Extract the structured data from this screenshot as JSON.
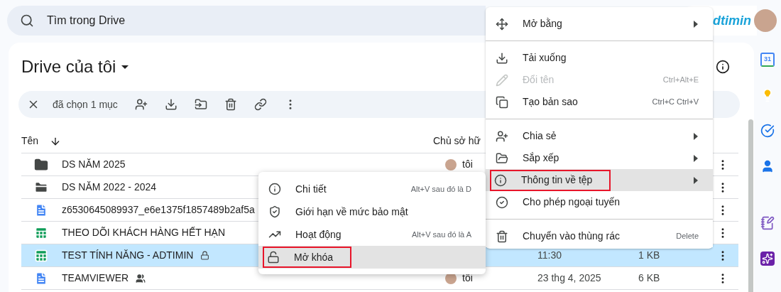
{
  "search": {
    "placeholder": "Tìm trong Drive"
  },
  "logo": "dtimin",
  "title": "Drive của tôi",
  "selection_bar": {
    "label": "đã chọn 1 mục"
  },
  "table": {
    "columns": [
      "Tên",
      "Chủ sở hữ"
    ],
    "rows": [
      {
        "kind": "folder",
        "name": "DS NĂM 2025",
        "owner": "tôi",
        "selected": false
      },
      {
        "kind": "shared-folder",
        "name": "DS NĂM 2022 - 2024",
        "selected": false
      },
      {
        "kind": "doc",
        "name": "z6530645089937_e6e1375f1857489b2af5a",
        "selected": false
      },
      {
        "kind": "sheet",
        "name": "THEO DÕI KHÁCH HÀNG HẾT HẠN",
        "selected": false
      },
      {
        "kind": "sheet",
        "name": "TEST TÍNH NĂNG - ADTIMIN",
        "locked": true,
        "date": "11:30",
        "size": "1 KB",
        "selected": true
      },
      {
        "kind": "doc",
        "name": "TEAMVIEWER",
        "shared": true,
        "owner": "tôi",
        "date": "23 thg 4, 2025",
        "size": "6 KB",
        "selected": false
      }
    ]
  },
  "context_menu": {
    "groups": [
      [
        {
          "label": "Mở bằng",
          "submenu": true,
          "disabled": false,
          "selected": false,
          "outlined": false
        }
      ],
      [
        {
          "label": "Tải xuống",
          "submenu": false,
          "disabled": false,
          "selected": false,
          "outlined": false
        },
        {
          "label": "Đổi tên",
          "shortcut": "Ctrl+Alt+E",
          "submenu": false,
          "disabled": true,
          "selected": false,
          "outlined": false
        },
        {
          "label": "Tạo bản sao",
          "shortcut": "Ctrl+C Ctrl+V",
          "submenu": false,
          "disabled": false,
          "selected": false,
          "outlined": false
        }
      ],
      [
        {
          "label": "Chia sẻ",
          "submenu": true,
          "disabled": false,
          "selected": false,
          "outlined": false
        },
        {
          "label": "Sắp xếp",
          "submenu": true,
          "disabled": false,
          "selected": false,
          "outlined": false
        },
        {
          "label": "Thông tin về tệp",
          "submenu": true,
          "disabled": false,
          "selected": true,
          "outlined": true
        },
        {
          "label": "Cho phép ngoại tuyến",
          "submenu": false,
          "disabled": false,
          "selected": false,
          "outlined": false
        }
      ],
      [
        {
          "label": "Chuyển vào thùng rác",
          "shortcut": "Delete",
          "submenu": false,
          "disabled": false,
          "selected": false,
          "outlined": false
        }
      ]
    ]
  },
  "submenu": {
    "items": [
      {
        "label": "Chi tiết",
        "shortcut": "Alt+V sau đó là D",
        "selected": false,
        "outlined": false
      },
      {
        "label": "Giới hạn về mức bảo mật",
        "selected": false,
        "outlined": false
      },
      {
        "label": "Hoạt động",
        "shortcut": "Alt+V sau đó là A",
        "selected": false,
        "outlined": false
      },
      {
        "label": "Mở khóa",
        "selected": true,
        "outlined": true
      }
    ]
  },
  "side_panel": {
    "calendar_day": "31"
  }
}
